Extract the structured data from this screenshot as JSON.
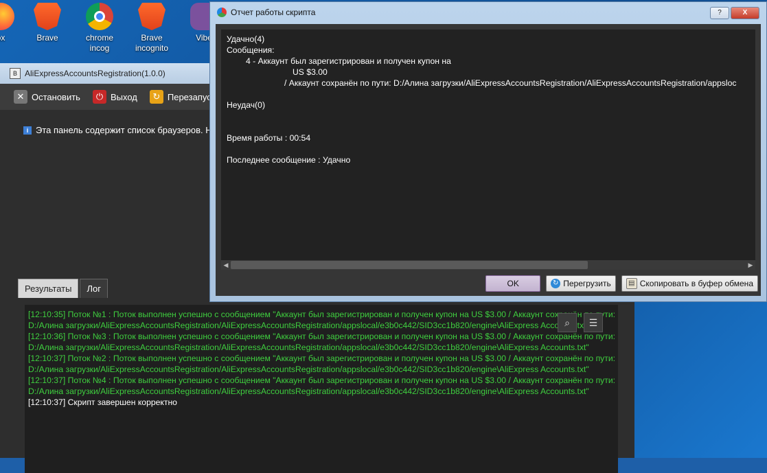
{
  "desktop": {
    "icons": [
      {
        "name": "firefox",
        "line1": "ox",
        "line2": ""
      },
      {
        "name": "brave",
        "line1": "Brave",
        "line2": ""
      },
      {
        "name": "chrome",
        "line1": "chrome",
        "line2": "incog"
      },
      {
        "name": "brave-incognito",
        "line1": "Brave",
        "line2": "incognito"
      },
      {
        "name": "viber",
        "line1": "Vibe",
        "line2": ""
      }
    ]
  },
  "main_window": {
    "title": "AliExpressAccountsRegistration(1.0.0)",
    "toolbar": {
      "stop_label": "Остановить",
      "exit_label": "Выход",
      "restart_label": "Перезапус"
    },
    "info_text": "Эта панель содержит список браузеров. Н",
    "tabs": [
      "Результаты",
      "Лог"
    ],
    "active_tab": "Лог",
    "log": [
      {
        "text": "[12:10:35] Поток №1 : Поток выполнен успешно с сообщением \"Аккаунт был зарегистрирован и получен купон на US $3.00 / Аккаунт сохранён по пути: D:/Алина загрузки/AliExpressAccountsRegistration/AliExpressAccountsRegistration/appslocal/e3b0c442/SID3cc1b820/engine\\AliExpress Accounts.txt\"",
        "kind": "ok"
      },
      {
        "text": "[12:10:36] Поток №3 : Поток выполнен успешно с сообщением \"Аккаунт был зарегистрирован и получен купон на US $3.00 / Аккаунт сохранён по пути: D:/Алина загрузки/AliExpressAccountsRegistration/AliExpressAccountsRegistration/appslocal/e3b0c442/SID3cc1b820/engine\\AliExpress Accounts.txt\"",
        "kind": "ok"
      },
      {
        "text": "[12:10:37] Поток №2 : Поток выполнен успешно с сообщением \"Аккаунт был зарегистрирован и получен купон на US $3.00 / Аккаунт сохранён по пути: D:/Алина загрузки/AliExpressAccountsRegistration/AliExpressAccountsRegistration/appslocal/e3b0c442/SID3cc1b820/engine\\AliExpress Accounts.txt\"",
        "kind": "ok"
      },
      {
        "text": "[12:10:37] Поток №4 : Поток выполнен успешно с сообщением \"Аккаунт был зарегистрирован и получен купон на US $3.00 / Аккаунт сохранён по пути: D:/Алина загрузки/AliExpressAccountsRegistration/AliExpressAccountsRegistration/appslocal/e3b0c442/SID3cc1b820/engine\\AliExpress Accounts.txt\"",
        "kind": "ok"
      },
      {
        "text": "[12:10:37] Скрипт завершен корректно",
        "kind": "plain"
      }
    ]
  },
  "dialog": {
    "title": "Отчет работы скрипта",
    "help_label": "?",
    "close_label": "X",
    "report": {
      "success": "Удачно(4)",
      "messages_label": "Сообщения:",
      "message_line1": "4 - Аккаунт был зарегистрирован и получен купон на",
      "message_line2": "US $3.00",
      "message_line3": "/ Аккаунт сохранён по пути: D:/Алина загрузки/AliExpressAccountsRegistration/AliExpressAccountsRegistration/appsloc",
      "fail": "Неудач(0)",
      "runtime": "Время работы : 00:54",
      "last_message": "Последнее сообщение : Удачно"
    },
    "buttons": {
      "ok": "OK",
      "reload": "Перегрузить",
      "copy": "Скопировать в буфер обмена"
    }
  },
  "colors": {
    "log_success": "#3fcf3f",
    "log_plain": "#ffffff",
    "dialog_frame": "#a9c3df"
  }
}
